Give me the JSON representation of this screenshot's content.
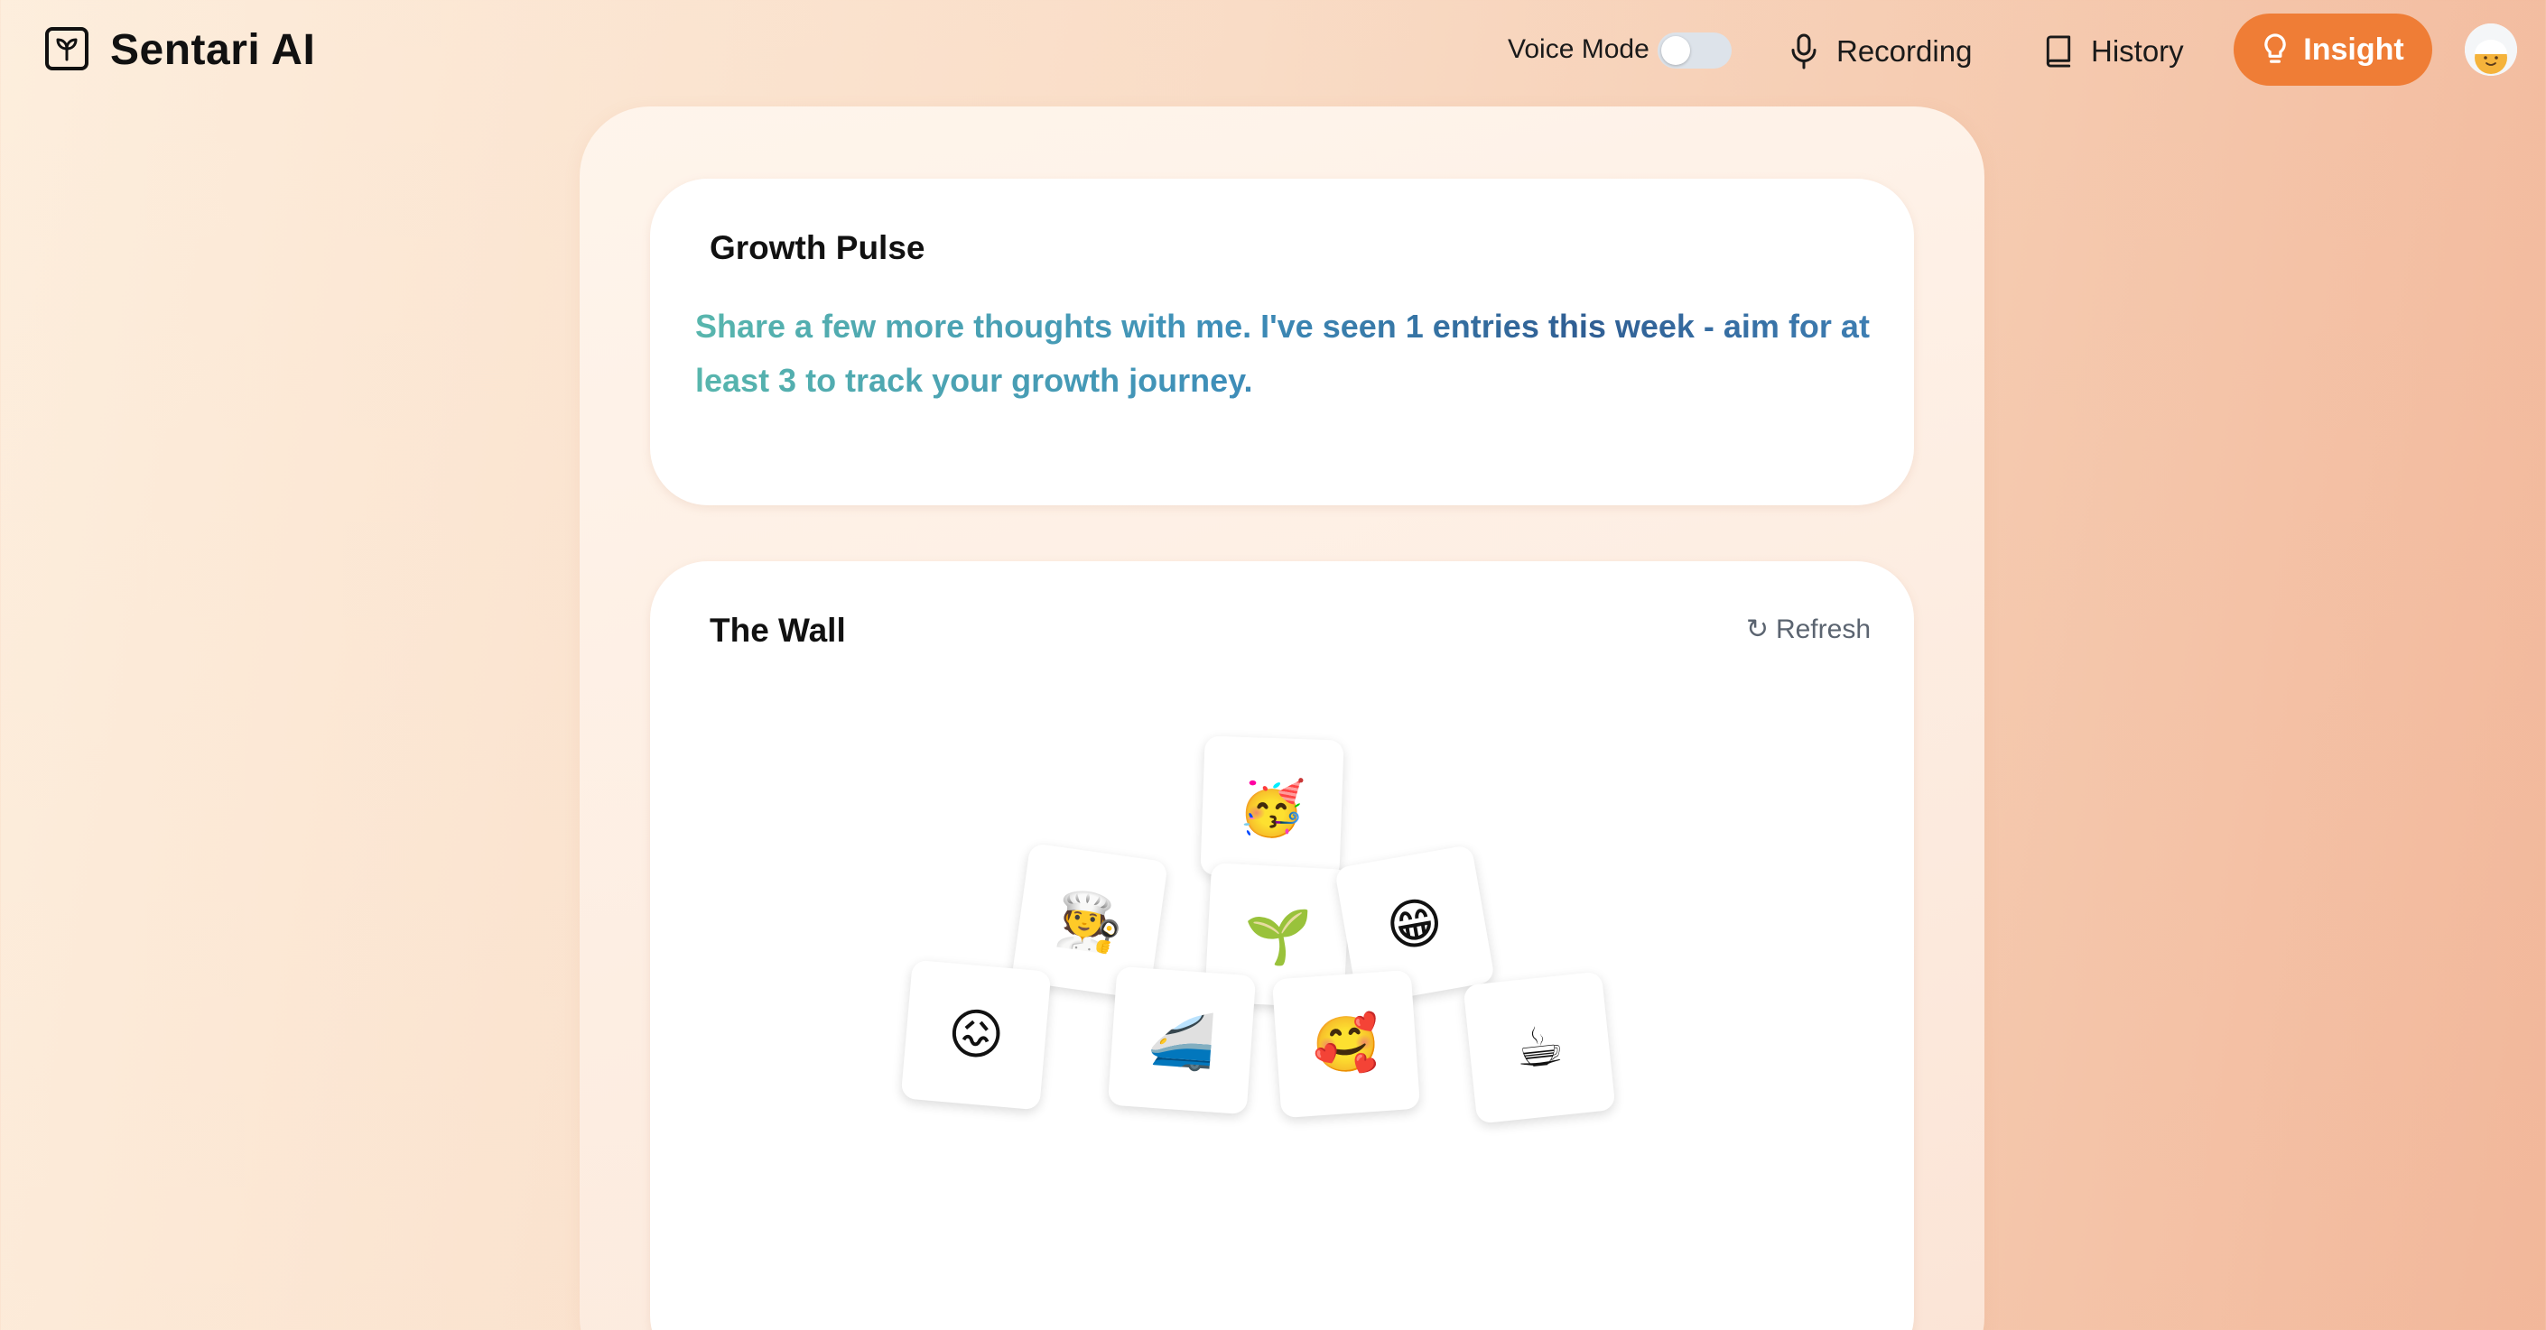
{
  "header": {
    "brand": "Sentari AI",
    "voice_mode_label": "Voice Mode",
    "voice_mode_on": false,
    "recording_label": "Recording",
    "history_label": "History",
    "insight_label": "Insight",
    "accent_color": "#ef7d36"
  },
  "growth_pulse": {
    "title": "Growth Pulse",
    "message": "Share a few more thoughts with me. I've seen 1 entries this week - aim for at least 3 to track your growth journey."
  },
  "wall": {
    "title": "The Wall",
    "refresh_label": "Refresh",
    "tiles": [
      {
        "emoji": "🥳",
        "icon": "partying-face-icon"
      },
      {
        "emoji": "🧑‍🍳",
        "icon": "cook-icon"
      },
      {
        "emoji": "🌱",
        "icon": "seedling-icon"
      },
      {
        "emoji": "😁",
        "icon": "grinning-face-icon"
      },
      {
        "emoji": "😖",
        "icon": "confounded-face-icon"
      },
      {
        "emoji": "🚄",
        "icon": "train-icon"
      },
      {
        "emoji": "🥰",
        "icon": "smiling-hearts-face-icon"
      },
      {
        "emoji": "☕",
        "icon": "coffee-icon"
      }
    ]
  }
}
